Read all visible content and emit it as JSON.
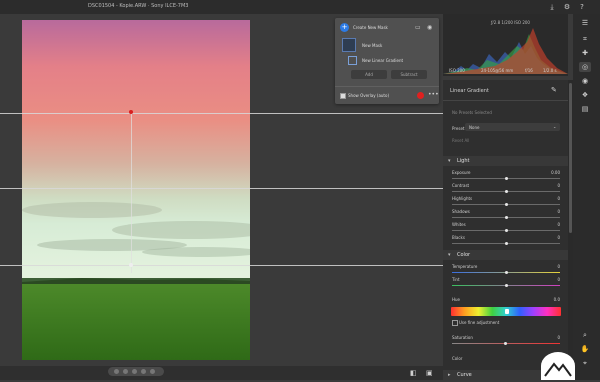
{
  "window": {
    "title": "DSC01504 - Kopie.ARW  ·  Sony ILCE-7M3"
  },
  "mask_panel": {
    "create_label": "Create New Mask",
    "mask1_label": "New Mask",
    "mask2_label": "New Linear Gradient",
    "add_label": "Add",
    "subtract_label": "Subtract",
    "overlay_label": "Show Overlay (auto)"
  },
  "histogram": {
    "top_readout": "ƒ/2.8  1/200  ISO 200",
    "iso": "ISO 200",
    "lens": "24-105@56 mm",
    "aperture": "f/16",
    "shutter": "1/2.0 s"
  },
  "panel": {
    "header": "Linear Gradient",
    "no_points": "No Presets Selected",
    "preset_label": "Preset",
    "preset_value": "None",
    "reset_label": "Reset All",
    "sections": {
      "light": "Light",
      "color": "Color",
      "curve": "Curve"
    },
    "light_sliders": [
      {
        "label": "Exposure",
        "value": "0.00",
        "pos": 0.5
      },
      {
        "label": "Contrast",
        "value": "0",
        "pos": 0.5
      },
      {
        "label": "Highlights",
        "value": "0",
        "pos": 0.5
      },
      {
        "label": "Shadows",
        "value": "0",
        "pos": 0.5
      },
      {
        "label": "Whites",
        "value": "0",
        "pos": 0.5
      },
      {
        "label": "Blacks",
        "value": "0",
        "pos": 0.5
      }
    ],
    "color_sliders": [
      {
        "label": "Temperature",
        "value": "0",
        "pos": 0.5
      },
      {
        "label": "Tint",
        "value": "0",
        "pos": 0.5
      }
    ],
    "hue_label": "Hue",
    "hue_value": "0.0",
    "fine_adjust_label": "Use fine adjustment",
    "saturation_label": "Saturation",
    "saturation_value": "0",
    "color_label": "Color"
  },
  "colors": {
    "accent_blue": "#2d7be5",
    "overlay_red": "#e0201f",
    "pin_red": "#d81f1f"
  }
}
